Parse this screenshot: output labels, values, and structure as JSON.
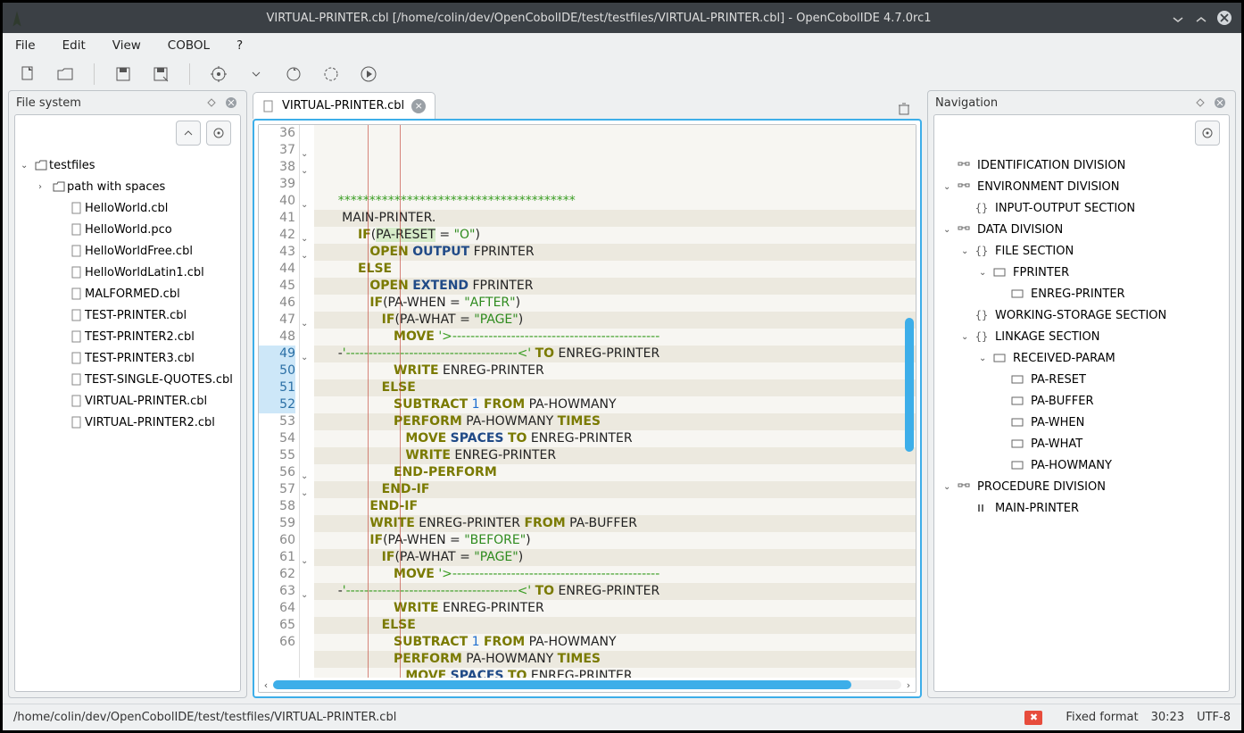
{
  "title": "VIRTUAL-PRINTER.cbl [/home/colin/dev/OpenCobolIDE/test/testfiles/VIRTUAL-PRINTER.cbl] - OpenCobolIDE 4.7.0rc1",
  "menu": {
    "file": "File",
    "edit": "Edit",
    "view": "View",
    "cobol": "COBOL",
    "help": "?"
  },
  "panels": {
    "filesystem": "File system",
    "navigation": "Navigation"
  },
  "fileTree": {
    "root": "testfiles",
    "folder": "path with spaces",
    "files": [
      "HelloWorld.cbl",
      "HelloWorld.pco",
      "HelloWorldFree.cbl",
      "HelloWorldLatin1.cbl",
      "MALFORMED.cbl",
      "TEST-PRINTER.cbl",
      "TEST-PRINTER2.cbl",
      "TEST-PRINTER3.cbl",
      "TEST-SINGLE-QUOTES.cbl",
      "VIRTUAL-PRINTER.cbl",
      "VIRTUAL-PRINTER2.cbl"
    ]
  },
  "tab": {
    "label": "VIRTUAL-PRINTER.cbl"
  },
  "editor": {
    "firstLine": 36,
    "currentLine": 49,
    "selectionLines": [
      49,
      50,
      51,
      52
    ],
    "lines": [
      {
        "n": 36,
        "tokens": [
          {
            "t": "      ",
            "c": "txt"
          },
          {
            "t": "*",
            "c": "cmt"
          },
          {
            "t": "*************************************",
            "c": "cmt"
          }
        ]
      },
      {
        "n": 37,
        "fold": true,
        "tokens": [
          {
            "t": "       MAIN-PRINTER.",
            "c": "txt"
          }
        ]
      },
      {
        "n": 38,
        "fold": true,
        "tokens": [
          {
            "t": "           ",
            "c": "txt"
          },
          {
            "t": "IF",
            "c": "sec"
          },
          {
            "t": "(",
            "c": "txt"
          },
          {
            "t": "PA-RESET",
            "c": "txt",
            "bg": "hl"
          },
          {
            "t": " = ",
            "c": "txt"
          },
          {
            "t": "\"O\"",
            "c": "str"
          },
          {
            "t": ")",
            "c": "txt"
          }
        ]
      },
      {
        "n": 39,
        "tokens": [
          {
            "t": "              ",
            "c": "txt"
          },
          {
            "t": "OPEN",
            "c": "sec"
          },
          {
            "t": " ",
            "c": "txt"
          },
          {
            "t": "OUTPUT",
            "c": "kw"
          },
          {
            "t": " FPRINTER",
            "c": "txt"
          }
        ]
      },
      {
        "n": 40,
        "fold": true,
        "tokens": [
          {
            "t": "           ",
            "c": "txt"
          },
          {
            "t": "ELSE",
            "c": "sec"
          }
        ]
      },
      {
        "n": 41,
        "tokens": [
          {
            "t": "              ",
            "c": "txt"
          },
          {
            "t": "OPEN",
            "c": "sec"
          },
          {
            "t": " ",
            "c": "txt"
          },
          {
            "t": "EXTEND",
            "c": "kw"
          },
          {
            "t": " FPRINTER",
            "c": "txt"
          }
        ]
      },
      {
        "n": 42,
        "fold": true,
        "tokens": [
          {
            "t": "              ",
            "c": "txt"
          },
          {
            "t": "IF",
            "c": "sec"
          },
          {
            "t": "(PA-WHEN = ",
            "c": "txt"
          },
          {
            "t": "\"AFTER\"",
            "c": "str"
          },
          {
            "t": ")",
            "c": "txt"
          }
        ]
      },
      {
        "n": 43,
        "fold": true,
        "tokens": [
          {
            "t": "                 ",
            "c": "txt"
          },
          {
            "t": "IF",
            "c": "sec"
          },
          {
            "t": "(PA-WHAT = ",
            "c": "txt"
          },
          {
            "t": "\"PAGE\"",
            "c": "str"
          },
          {
            "t": ")",
            "c": "txt"
          }
        ]
      },
      {
        "n": 44,
        "tokens": [
          {
            "t": "                    ",
            "c": "txt"
          },
          {
            "t": "MOVE",
            "c": "sec"
          },
          {
            "t": " ",
            "c": "txt"
          },
          {
            "t": "'>----------------------------------------------",
            "c": "cmt"
          }
        ]
      },
      {
        "n": 45,
        "tokens": [
          {
            "t": "      -",
            "c": "txt"
          },
          {
            "t": "'--------------------------------------<'",
            "c": "cmt"
          },
          {
            "t": " ",
            "c": "txt"
          },
          {
            "t": "TO",
            "c": "sec"
          },
          {
            "t": " ENREG-PRINTER",
            "c": "txt"
          }
        ]
      },
      {
        "n": 46,
        "tokens": [
          {
            "t": "                    ",
            "c": "txt"
          },
          {
            "t": "WRITE",
            "c": "sec"
          },
          {
            "t": " ENREG-PRINTER",
            "c": "txt"
          }
        ]
      },
      {
        "n": 47,
        "fold": true,
        "tokens": [
          {
            "t": "                 ",
            "c": "txt"
          },
          {
            "t": "ELSE",
            "c": "sec"
          }
        ]
      },
      {
        "n": 48,
        "tokens": [
          {
            "t": "                    ",
            "c": "txt"
          },
          {
            "t": "SUBTRACT",
            "c": "sec"
          },
          {
            "t": " ",
            "c": "txt"
          },
          {
            "t": "1",
            "c": "num"
          },
          {
            "t": " ",
            "c": "txt"
          },
          {
            "t": "FROM",
            "c": "sec"
          },
          {
            "t": " PA-HOWMANY",
            "c": "txt"
          }
        ]
      },
      {
        "n": 49,
        "fold": true,
        "tokens": [
          {
            "t": "                    ",
            "c": "txt"
          },
          {
            "t": "PERFORM",
            "c": "sec"
          },
          {
            "t": " PA-HOWMANY ",
            "c": "txt"
          },
          {
            "t": "TIMES",
            "c": "sec"
          }
        ]
      },
      {
        "n": 50,
        "tokens": [
          {
            "t": "                       ",
            "c": "txt"
          },
          {
            "t": "MOVE",
            "c": "sec"
          },
          {
            "t": " ",
            "c": "txt"
          },
          {
            "t": "SPACES",
            "c": "kw"
          },
          {
            "t": " ",
            "c": "txt"
          },
          {
            "t": "TO",
            "c": "sec"
          },
          {
            "t": " ENREG-PRINTER",
            "c": "txt"
          }
        ]
      },
      {
        "n": 51,
        "tokens": [
          {
            "t": "                       ",
            "c": "txt"
          },
          {
            "t": "WRITE",
            "c": "sec"
          },
          {
            "t": " ENREG-PRINTER",
            "c": "txt"
          }
        ]
      },
      {
        "n": 52,
        "tokens": [
          {
            "t": "                    ",
            "c": "txt"
          },
          {
            "t": "END-PERFORM",
            "c": "sec"
          }
        ]
      },
      {
        "n": 53,
        "tokens": [
          {
            "t": "                 ",
            "c": "txt"
          },
          {
            "t": "END-IF",
            "c": "sec"
          }
        ]
      },
      {
        "n": 54,
        "tokens": [
          {
            "t": "              ",
            "c": "txt"
          },
          {
            "t": "END-IF",
            "c": "sec"
          }
        ]
      },
      {
        "n": 55,
        "tokens": [
          {
            "t": "              ",
            "c": "txt"
          },
          {
            "t": "WRITE",
            "c": "sec"
          },
          {
            "t": " ENREG-PRINTER ",
            "c": "txt"
          },
          {
            "t": "FROM",
            "c": "sec"
          },
          {
            "t": " PA-BUFFER",
            "c": "txt"
          }
        ]
      },
      {
        "n": 56,
        "fold": true,
        "tokens": [
          {
            "t": "              ",
            "c": "txt"
          },
          {
            "t": "IF",
            "c": "sec"
          },
          {
            "t": "(PA-WHEN = ",
            "c": "txt"
          },
          {
            "t": "\"BEFORE\"",
            "c": "str"
          },
          {
            "t": ")",
            "c": "txt"
          }
        ]
      },
      {
        "n": 57,
        "fold": true,
        "tokens": [
          {
            "t": "                 ",
            "c": "txt"
          },
          {
            "t": "IF",
            "c": "sec"
          },
          {
            "t": "(PA-WHAT = ",
            "c": "txt"
          },
          {
            "t": "\"PAGE\"",
            "c": "str"
          },
          {
            "t": ")",
            "c": "txt"
          }
        ]
      },
      {
        "n": 58,
        "tokens": [
          {
            "t": "                    ",
            "c": "txt"
          },
          {
            "t": "MOVE",
            "c": "sec"
          },
          {
            "t": " ",
            "c": "txt"
          },
          {
            "t": "'>----------------------------------------------",
            "c": "cmt"
          }
        ]
      },
      {
        "n": 59,
        "tokens": [
          {
            "t": "      -",
            "c": "txt"
          },
          {
            "t": "'--------------------------------------<'",
            "c": "cmt"
          },
          {
            "t": " ",
            "c": "txt"
          },
          {
            "t": "TO",
            "c": "sec"
          },
          {
            "t": " ENREG-PRINTER",
            "c": "txt"
          }
        ]
      },
      {
        "n": 60,
        "tokens": [
          {
            "t": "                    ",
            "c": "txt"
          },
          {
            "t": "WRITE",
            "c": "sec"
          },
          {
            "t": " ENREG-PRINTER",
            "c": "txt"
          }
        ]
      },
      {
        "n": 61,
        "fold": true,
        "tokens": [
          {
            "t": "                 ",
            "c": "txt"
          },
          {
            "t": "ELSE",
            "c": "sec"
          }
        ]
      },
      {
        "n": 62,
        "tokens": [
          {
            "t": "                    ",
            "c": "txt"
          },
          {
            "t": "SUBTRACT",
            "c": "sec"
          },
          {
            "t": " ",
            "c": "txt"
          },
          {
            "t": "1",
            "c": "num"
          },
          {
            "t": " ",
            "c": "txt"
          },
          {
            "t": "FROM",
            "c": "sec"
          },
          {
            "t": " PA-HOWMANY",
            "c": "txt"
          }
        ]
      },
      {
        "n": 63,
        "fold": true,
        "tokens": [
          {
            "t": "                    ",
            "c": "txt"
          },
          {
            "t": "PERFORM",
            "c": "sec"
          },
          {
            "t": " PA-HOWMANY ",
            "c": "txt"
          },
          {
            "t": "TIMES",
            "c": "sec"
          }
        ]
      },
      {
        "n": 64,
        "tokens": [
          {
            "t": "                       ",
            "c": "txt"
          },
          {
            "t": "MOVE",
            "c": "sec"
          },
          {
            "t": " ",
            "c": "txt"
          },
          {
            "t": "SPACES",
            "c": "kw"
          },
          {
            "t": " ",
            "c": "txt"
          },
          {
            "t": "TO",
            "c": "sec"
          },
          {
            "t": " ENREG-PRINTER",
            "c": "txt"
          }
        ]
      },
      {
        "n": 65,
        "tokens": [
          {
            "t": "                       ",
            "c": "txt"
          },
          {
            "t": "WRITE",
            "c": "sec"
          },
          {
            "t": " ENREG-PRINTER",
            "c": "txt"
          }
        ]
      },
      {
        "n": 66,
        "tokens": [
          {
            "t": "                    ",
            "c": "txt"
          },
          {
            "t": "END-PERFORM",
            "c": "sec"
          }
        ]
      }
    ]
  },
  "navigation": [
    {
      "d": 0,
      "chev": "",
      "ico": "div",
      "label": "IDENTIFICATION DIVISION"
    },
    {
      "d": 0,
      "chev": "v",
      "ico": "div",
      "label": "ENVIRONMENT DIVISION"
    },
    {
      "d": 1,
      "chev": "",
      "ico": "sec",
      "label": "INPUT-OUTPUT SECTION"
    },
    {
      "d": 0,
      "chev": "v",
      "ico": "div",
      "label": "DATA DIVISION"
    },
    {
      "d": 1,
      "chev": "v",
      "ico": "sec",
      "label": "FILE SECTION"
    },
    {
      "d": 2,
      "chev": "v",
      "ico": "var",
      "label": "FPRINTER"
    },
    {
      "d": 3,
      "chev": "",
      "ico": "var",
      "label": "ENREG-PRINTER"
    },
    {
      "d": 1,
      "chev": "",
      "ico": "sec",
      "label": "WORKING-STORAGE SECTION"
    },
    {
      "d": 1,
      "chev": "v",
      "ico": "sec",
      "label": "LINKAGE SECTION"
    },
    {
      "d": 2,
      "chev": "v",
      "ico": "var",
      "label": "RECEIVED-PARAM"
    },
    {
      "d": 3,
      "chev": "",
      "ico": "var",
      "label": "PA-RESET"
    },
    {
      "d": 3,
      "chev": "",
      "ico": "var",
      "label": "PA-BUFFER"
    },
    {
      "d": 3,
      "chev": "",
      "ico": "var",
      "label": "PA-WHEN"
    },
    {
      "d": 3,
      "chev": "",
      "ico": "var",
      "label": "PA-WHAT"
    },
    {
      "d": 3,
      "chev": "",
      "ico": "var",
      "label": "PA-HOWMANY"
    },
    {
      "d": 0,
      "chev": "v",
      "ico": "div",
      "label": "PROCEDURE DIVISION"
    },
    {
      "d": 1,
      "chev": "",
      "ico": "par",
      "label": "MAIN-PRINTER"
    }
  ],
  "status": {
    "path": "/home/colin/dev/OpenCobolIDE/test/testfiles/VIRTUAL-PRINTER.cbl",
    "format": "Fixed format",
    "cursor": "30:23",
    "encoding": "UTF-8"
  }
}
